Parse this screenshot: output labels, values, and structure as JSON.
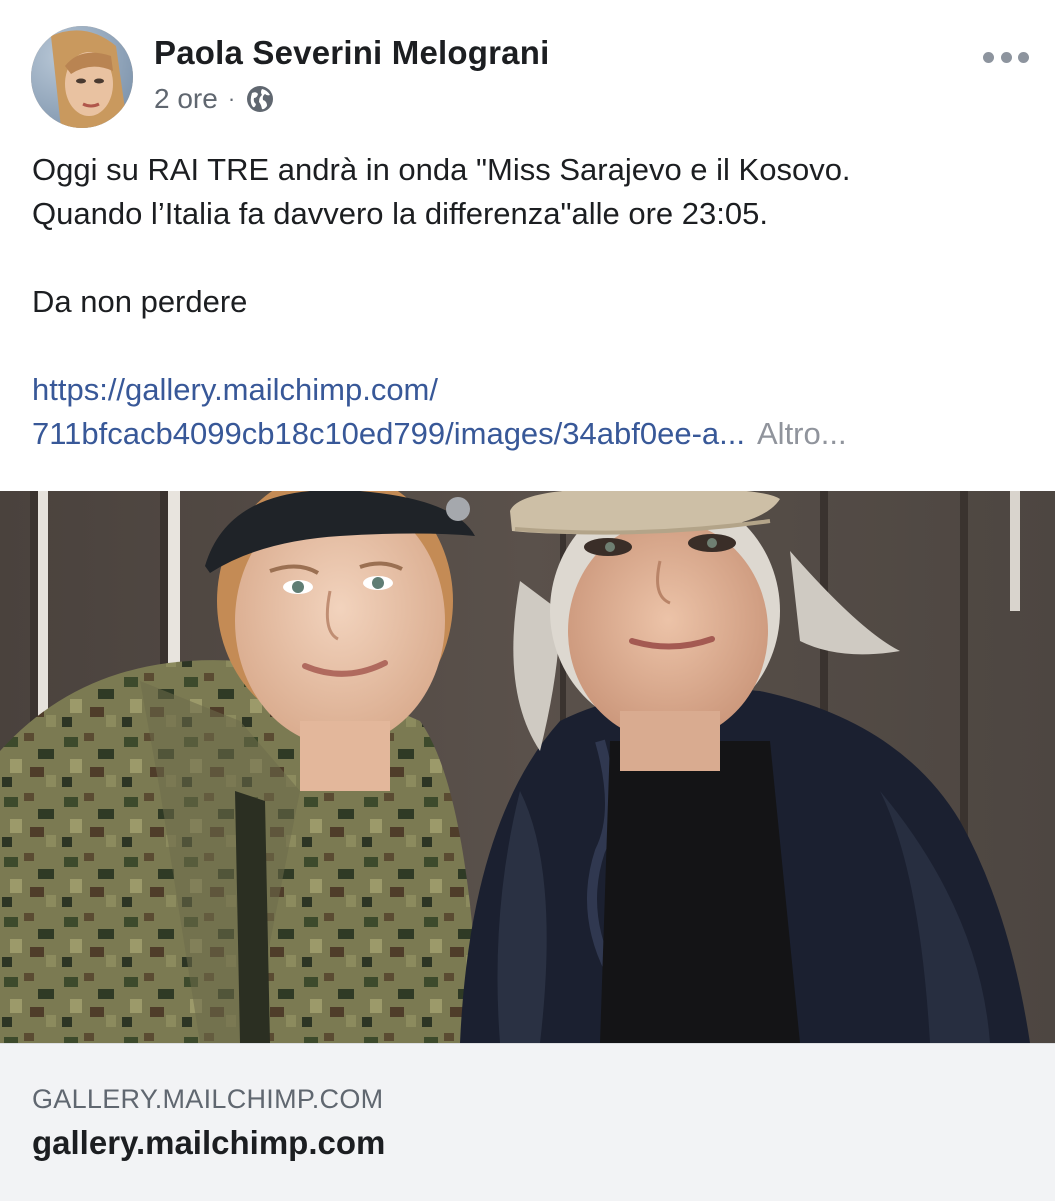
{
  "post": {
    "author": "Paola Severini Melograni",
    "time": "2 ore",
    "separator": "·",
    "privacy_icon": "globe-icon",
    "more_icon": "more-options-icon",
    "text_lines": [
      "Oggi su RAI TRE andrà in onda \"Miss Sarajevo e il Kosovo.",
      "Quando l’Italia fa davvero la differenza\"alle ore 23:05."
    ],
    "text_line3": "Da non perdere",
    "link_line1": "https://gallery.mailchimp.com/",
    "link_line2": "711bfcacb4099cb18c10ed799/images/34abf0ee-a...",
    "see_more": "Altro..."
  },
  "preview": {
    "domain": "GALLERY.MAILCHIMP.COM",
    "title": "gallery.mailchimp.com"
  },
  "colors": {
    "link": "#385898",
    "meta": "#606770",
    "preview_bg": "#f2f3f5"
  }
}
